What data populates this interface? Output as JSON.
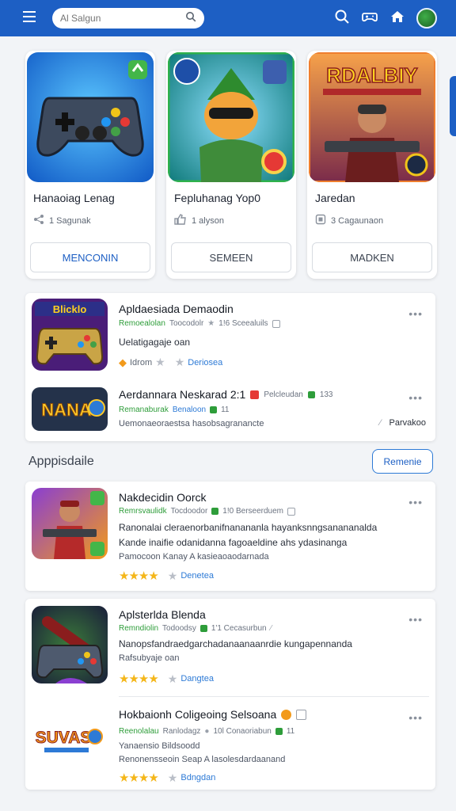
{
  "header": {
    "search_placeholder": "Al Salgun",
    "icons": [
      "menu-icon",
      "search-icon",
      "gamepad-icon",
      "home-icon",
      "avatar"
    ]
  },
  "featured": [
    {
      "title": "Hanaoiag Lenag",
      "meta": "1 Sagunak",
      "button": "MENCONIN",
      "icon": "gamepad-art"
    },
    {
      "title": "Fepluhanag Yop0",
      "meta": "1 alyson",
      "button": "SEMEEN",
      "icon": "hero-art"
    },
    {
      "title": "Jaredan",
      "meta": "3 Cagaunaon",
      "button": "MADKEN",
      "icon": "shooter-art",
      "thumb_text": "RDALBIY"
    }
  ],
  "list1": [
    {
      "title": "Apldaesiada Demaodin",
      "meta_green": "Remoealolan",
      "meta_gray": "Toocodolr",
      "meta_extra": "1!6  Sceealuils",
      "desc": "Uelatigagaje oan",
      "rating_text": "Idrom",
      "link": "Deriosea",
      "thumb_text": "Blicklo"
    },
    {
      "title": "Aerdannara Neskarad 2:1",
      "meta_extra_title": "Pelcleudan",
      "meta_count": "133",
      "meta_green": "Remanaburak",
      "meta_blue": "Benaloon",
      "meta_num": "11",
      "desc": "Uemonaeoraestsa hasobsagranancte",
      "link": "Parvakoo",
      "thumb_text": "NANA"
    }
  ],
  "section": {
    "title": "Apppisdaile",
    "button": "Remenie"
  },
  "list2": [
    {
      "title": "Nakdecidin Oorck",
      "meta_green": "Remrsvaulidk",
      "meta_gray": "Tocdoodor",
      "meta_extra": "1!0  Berseerduem",
      "desc1": "Ranonalai cleraenorbanifnanananla hayanksnngsanananalda",
      "desc2": "Kande inaifie odanidanna fagoaeldine ahs ydasinanga",
      "desc3": "Pamocoon  Kanay A  kasieaoaodarnada",
      "link": "Denetea"
    },
    {
      "title": "Aplsterlda Blenda",
      "meta_green": "Remndiolin",
      "meta_gray": "Todoodsy",
      "meta_extra": "1'1  Cecasurbun",
      "desc1": "Nanopsfandraedgarchadanaanaanrdie kungapennanda",
      "desc2": "Rafsubyaje oan",
      "link": "Dangtea"
    },
    {
      "title": "Hokbaionh Coligeoing Selsoana",
      "meta_green": "Reenolalau",
      "meta_gray": "Ranlodagz",
      "meta_extra": "10l  Conaoriabun",
      "meta_num": "11",
      "desc1": "Yanaensio Bildsoodd",
      "desc2": "Renonensseoin Seap A lasolesdardaanand",
      "link": "Bdngdan",
      "thumb_text": "SUVAS"
    }
  ],
  "colors": {
    "brand": "#1d5fc4",
    "accent_green": "#2e9d3a",
    "star": "#f4b619",
    "link": "#2d7ad6"
  }
}
